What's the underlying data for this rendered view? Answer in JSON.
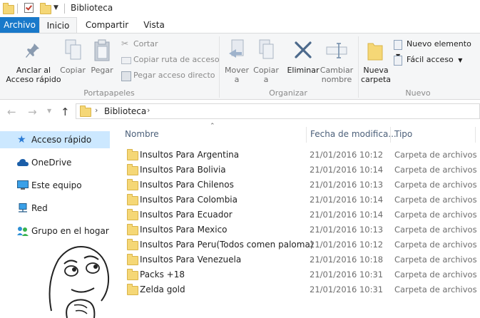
{
  "window": {
    "title": "Biblioteca"
  },
  "tabs": [
    {
      "label": "Archivo",
      "active": false
    },
    {
      "label": "Inicio",
      "active": true
    },
    {
      "label": "Compartir",
      "active": false
    },
    {
      "label": "Vista",
      "active": false
    }
  ],
  "ribbon": {
    "portapapeles": {
      "title": "Portapapeles",
      "anclar": "Anclar al Acceso rápido",
      "copiar": "Copiar",
      "pegar": "Pegar",
      "cortar": "Cortar",
      "copiar_ruta": "Copiar ruta de acceso",
      "pegar_acceso": "Pegar acceso directo"
    },
    "organizar": {
      "title": "Organizar",
      "mover": "Mover a",
      "copiar": "Copiar a",
      "eliminar": "Eliminar",
      "cambiar": "Cambiar nombre"
    },
    "nuevo": {
      "title": "Nuevo",
      "nueva_carpeta": "Nueva carpeta",
      "nuevo_elemento": "Nuevo elemento",
      "facil_acceso": "Fácil acceso"
    }
  },
  "address": {
    "path": "Biblioteca"
  },
  "nav": [
    {
      "label": "Acceso rápido",
      "icon": "star-icon",
      "selected": true
    },
    {
      "label": "OneDrive",
      "icon": "cloud-icon",
      "selected": false
    },
    {
      "label": "Este equipo",
      "icon": "computer-icon",
      "selected": false
    },
    {
      "label": "Red",
      "icon": "network-icon",
      "selected": false
    },
    {
      "label": "Grupo en el hogar",
      "icon": "homegroup-icon",
      "selected": false
    }
  ],
  "columns": {
    "name": "Nombre",
    "date": "Fecha de modifica...",
    "type": "Tipo"
  },
  "files": [
    {
      "name": "Insultos Para Argentina",
      "date": "21/01/2016 10:12",
      "type": "Carpeta de archivos"
    },
    {
      "name": "Insultos Para Bolivia",
      "date": "21/01/2016 10:14",
      "type": "Carpeta de archivos"
    },
    {
      "name": "Insultos Para Chilenos",
      "date": "21/01/2016 10:13",
      "type": "Carpeta de archivos"
    },
    {
      "name": "Insultos Para Colombia",
      "date": "21/01/2016 10:14",
      "type": "Carpeta de archivos"
    },
    {
      "name": "Insultos Para Ecuador",
      "date": "21/01/2016 10:14",
      "type": "Carpeta de archivos"
    },
    {
      "name": "Insultos Para Mexico",
      "date": "21/01/2016 10:13",
      "type": "Carpeta de archivos"
    },
    {
      "name": "Insultos Para Peru(Todos comen paloma)",
      "date": "21/01/2016 10:12",
      "type": "Carpeta de archivos"
    },
    {
      "name": "Insultos Para Venezuela",
      "date": "21/01/2016 10:18",
      "type": "Carpeta de archivos"
    },
    {
      "name": "Packs +18",
      "date": "21/01/2016 10:31",
      "type": "Carpeta de archivos"
    },
    {
      "name": "Zelda gold",
      "date": "21/01/2016 10:31",
      "type": "Carpeta de archivos"
    }
  ],
  "colors": {
    "accent": "#1979ca",
    "selection": "#cce8ff",
    "folder": "#f5d776"
  }
}
